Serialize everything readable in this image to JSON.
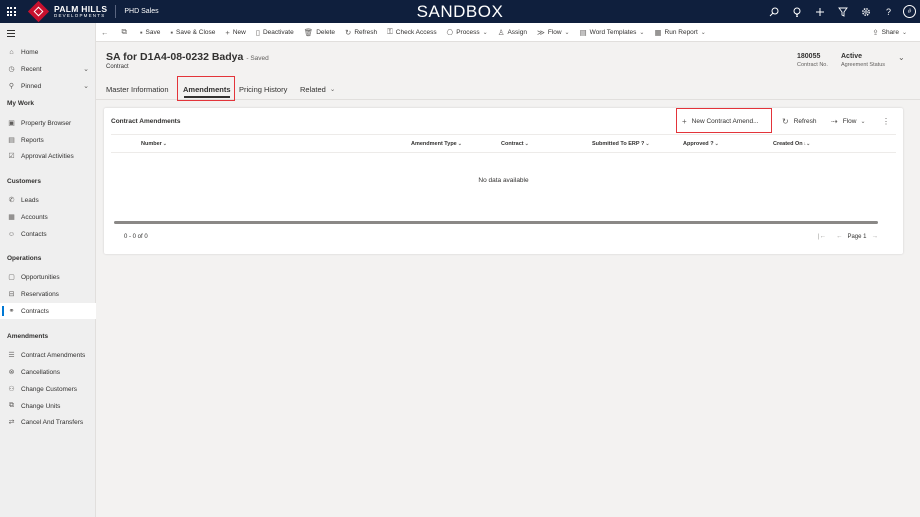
{
  "topbar": {
    "brand_line1": "PALM HILLS",
    "brand_line2": "DEVELOPMENTS",
    "app_name": "PHD Sales",
    "environment": "SANDBOX",
    "avatar_initial": "#"
  },
  "sidebar": {
    "items_top": [
      {
        "label": "Home",
        "icon": "home-icon"
      },
      {
        "label": "Recent",
        "icon": "clock-icon"
      },
      {
        "label": "Pinned",
        "icon": "pin-icon"
      }
    ],
    "groups": [
      {
        "title": "My Work",
        "items": [
          {
            "label": "Property Browser",
            "icon": "browser-icon"
          },
          {
            "label": "Reports",
            "icon": "report-icon"
          },
          {
            "label": "Approval Activities",
            "icon": "approval-icon"
          }
        ]
      },
      {
        "title": "Customers",
        "items": [
          {
            "label": "Leads",
            "icon": "phone-icon"
          },
          {
            "label": "Accounts",
            "icon": "building-icon"
          },
          {
            "label": "Contacts",
            "icon": "contact-icon"
          }
        ]
      },
      {
        "title": "Operations",
        "items": [
          {
            "label": "Opportunities",
            "icon": "document-icon"
          },
          {
            "label": "Reservations",
            "icon": "reservation-icon"
          },
          {
            "label": "Contracts",
            "icon": "handshake-icon"
          }
        ]
      },
      {
        "title": "Amendments",
        "items": [
          {
            "label": "Contract Amendments",
            "icon": "list-icon"
          },
          {
            "label": "Cancellations",
            "icon": "cancel-icon"
          },
          {
            "label": "Change Customers",
            "icon": "people-icon"
          },
          {
            "label": "Change Units",
            "icon": "units-icon"
          },
          {
            "label": "Cancel And Transfers",
            "icon": "transfer-icon"
          }
        ]
      }
    ]
  },
  "commandbar": {
    "save": "Save",
    "save_close": "Save & Close",
    "new": "New",
    "deactivate": "Deactivate",
    "delete": "Delete",
    "refresh": "Refresh",
    "check_access": "Check Access",
    "process": "Process",
    "assign": "Assign",
    "flow": "Flow",
    "word_templates": "Word Templates",
    "run_report": "Run Report",
    "share": "Share"
  },
  "record": {
    "title": "SA for D1A4-08-0232 Badya",
    "save_status": "- Saved",
    "entity": "Contract",
    "contract_no_value": "180055",
    "contract_no_label": "Contract No.",
    "status_value": "Active",
    "status_label": "Agreement Status"
  },
  "tabs": [
    "Master Information",
    "Amendments",
    "Pricing History",
    "Related"
  ],
  "subgrid": {
    "title": "Contract Amendments",
    "new_button": "New Contract Amend...",
    "refresh": "Refresh",
    "flow": "Flow",
    "columns": [
      "Number",
      "Amendment Type",
      "Contract",
      "Submitted To ERP ?",
      "Approved ?",
      "Created On"
    ],
    "empty_message": "No data available",
    "record_count": "0 - 0 of 0",
    "page_label": "Page 1"
  },
  "colors": {
    "topbar_bg": "#0f1f3d",
    "brand_red": "#c8102e",
    "highlight_box": "#e3343a",
    "accent_blue": "#0078d4"
  }
}
